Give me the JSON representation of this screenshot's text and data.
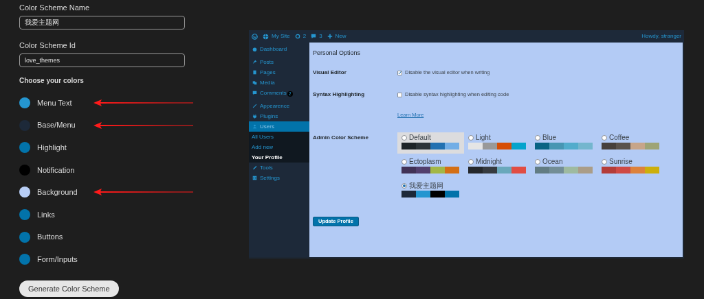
{
  "form": {
    "name_label": "Color Scheme Name",
    "name_value": "我爱主题网",
    "id_label": "Color Scheme Id",
    "id_value": "love_themes",
    "colors_heading": "Choose your colors",
    "colors": [
      {
        "label": "Menu Text",
        "color": "#2596d0",
        "marked": true
      },
      {
        "label": "Base/Menu",
        "color": "#1d2939",
        "marked": true
      },
      {
        "label": "Highlight",
        "color": "#0273aa",
        "marked": false
      },
      {
        "label": "Notification",
        "color": "#000000",
        "marked": false
      },
      {
        "label": "Background",
        "color": "#b7cdf5",
        "marked": true
      },
      {
        "label": "Links",
        "color": "#0273aa",
        "marked": false
      },
      {
        "label": "Buttons",
        "color": "#0273aa",
        "marked": false
      },
      {
        "label": "Form/Inputs",
        "color": "#0273aa",
        "marked": false
      }
    ],
    "submit": "Generate Color Scheme"
  },
  "preview": {
    "admin_bar": {
      "site": "My Site",
      "updates": "2",
      "comments": "3",
      "new": "New",
      "greeting": "Howdy, stranger"
    },
    "sidebar": [
      [
        {
          "label": "Dashboard",
          "selected": false
        }
      ],
      [
        {
          "label": "Posts",
          "selected": false
        },
        {
          "label": "Pages",
          "selected": false
        },
        {
          "label": "Media",
          "selected": false
        },
        {
          "label": "Comments",
          "badge": "2",
          "selected": false
        }
      ],
      [
        {
          "label": "Appearence",
          "selected": false
        },
        {
          "label": "Plugins",
          "selected": false
        },
        {
          "label": "Users",
          "selected": true,
          "children": [
            {
              "label": "All Users",
              "selected": false
            },
            {
              "label": "Add new",
              "selected": false
            },
            {
              "label": "Your Profile",
              "selected": true
            }
          ]
        },
        {
          "label": "Tools",
          "selected": false
        },
        {
          "label": "Settings",
          "selected": false
        }
      ]
    ],
    "heading": "Personal Options",
    "visual_editor": {
      "label": "Visual Editor",
      "option": "Disable the visual editor when writing",
      "checked": true
    },
    "syntax": {
      "label": "Syntax Highlighting",
      "option": "Disable syntax highlighting when editing code",
      "checked": false
    },
    "learn_more": "Learn More",
    "scheme_label": "Admin Color Scheme",
    "schemes": [
      {
        "name": "Default",
        "selected": false,
        "highlighted": true,
        "swatches": [
          {
            "color": "#1d2327"
          },
          {
            "color": "#2c3338"
          },
          {
            "color": "#2271b1"
          },
          {
            "color": "#72aee6"
          }
        ]
      },
      {
        "name": "Light",
        "selected": false,
        "highlighted": false,
        "swatches": [
          {
            "color": "#e5e5e5"
          },
          {
            "color": "#999999"
          },
          {
            "color": "#d64e07"
          },
          {
            "color": "#04a4cc"
          }
        ]
      },
      {
        "name": "Blue",
        "selected": false,
        "highlighted": false,
        "swatches": [
          {
            "color": "#096484"
          },
          {
            "color": "#4796b3"
          },
          {
            "color": "#52accc"
          },
          {
            "color": "#74b6ce"
          }
        ]
      },
      {
        "name": "Coffee",
        "selected": false,
        "highlighted": false,
        "swatches": [
          {
            "color": "#46403c"
          },
          {
            "color": "#59524c"
          },
          {
            "color": "#c7a589"
          },
          {
            "color": "#9ea476"
          }
        ]
      },
      {
        "name": "Ectoplasm",
        "selected": false,
        "highlighted": false,
        "swatches": [
          {
            "color": "#413256"
          },
          {
            "color": "#523f6d"
          },
          {
            "color": "#a3b745"
          },
          {
            "color": "#d46f15"
          }
        ]
      },
      {
        "name": "Midnight",
        "selected": false,
        "highlighted": false,
        "swatches": [
          {
            "color": "#25282b"
          },
          {
            "color": "#363b3f"
          },
          {
            "color": "#69a8bb"
          },
          {
            "color": "#e14d43"
          }
        ]
      },
      {
        "name": "Ocean",
        "selected": false,
        "highlighted": false,
        "swatches": [
          {
            "color": "#627c83"
          },
          {
            "color": "#738e96"
          },
          {
            "color": "#9ebaa0"
          },
          {
            "color": "#aa9d88"
          }
        ]
      },
      {
        "name": "Sunrise",
        "selected": false,
        "highlighted": false,
        "swatches": [
          {
            "color": "#b43c38"
          },
          {
            "color": "#cf4944"
          },
          {
            "color": "#dd823b"
          },
          {
            "color": "#ccaf0b"
          }
        ]
      },
      {
        "name": "我爱主题网",
        "selected": true,
        "highlighted": false,
        "swatches": [
          {
            "color": "#1d2939"
          },
          {
            "color": "#2596d0"
          },
          {
            "color": "#000000"
          },
          {
            "color": "#0273aa"
          }
        ]
      }
    ],
    "update_button": "Update Profile"
  }
}
